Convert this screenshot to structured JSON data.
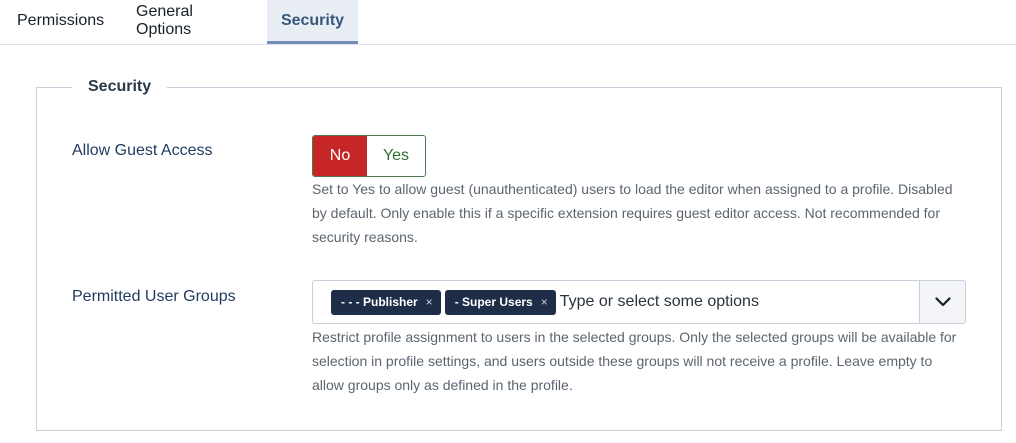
{
  "tabs": [
    {
      "label": "Permissions"
    },
    {
      "label": "General Options"
    },
    {
      "label": "Security"
    }
  ],
  "fieldset": {
    "legend": "Security"
  },
  "guest_access": {
    "label": "Allow Guest Access",
    "options": {
      "no": "No",
      "yes": "Yes"
    },
    "selected": "No",
    "description": "Set to Yes to allow guest (unauthenticated) users to load the editor when assigned to a profile. Disabled by default. Only enable this if a specific extension requires guest editor access. Not recommended for security reasons."
  },
  "user_groups": {
    "label": "Permitted User Groups",
    "chips": [
      {
        "label": "- - - Publisher",
        "remove": "×"
      },
      {
        "label": "- Super Users",
        "remove": "×"
      }
    ],
    "placeholder": "Type or select some options",
    "description": "Restrict profile assignment to users in the selected groups. Only the selected groups will be available for selection in profile settings, and users outside these groups will not receive a profile. Leave empty to allow groups only as defined in the profile."
  },
  "icons": {
    "dropdown": "chevron-down-icon",
    "chip_remove": "close-icon"
  },
  "colors": {
    "switch_no_bg": "#c72626",
    "switch_yes_text": "#2f6f2f",
    "chip_bg": "#1e2d48",
    "active_tab_text": "#38577d",
    "active_tab_bg": "#e9eef5"
  }
}
